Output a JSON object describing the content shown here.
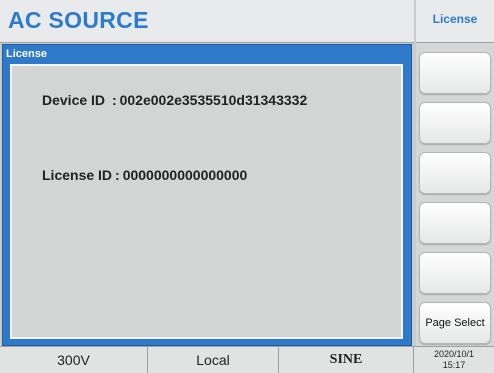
{
  "header": {
    "title": "AC SOURCE"
  },
  "panel": {
    "title": "License",
    "device": {
      "label": "Device ID",
      "separator": ":",
      "value": "002e002e3535510d31343332"
    },
    "license": {
      "label": "License ID",
      "separator": ":",
      "value": "0000000000000000"
    }
  },
  "softkeys": {
    "header": "License",
    "keys": [
      "",
      "",
      "",
      "",
      "",
      "Page Select"
    ]
  },
  "status_bar": {
    "voltage_range": "300V",
    "control_mode": "Local",
    "waveform": "SINE",
    "date": "2020/10/1",
    "time": "15:17"
  },
  "colors": {
    "accent": "#2c7bd0",
    "panel": "#2f79c9",
    "background": "#c9cbca"
  }
}
